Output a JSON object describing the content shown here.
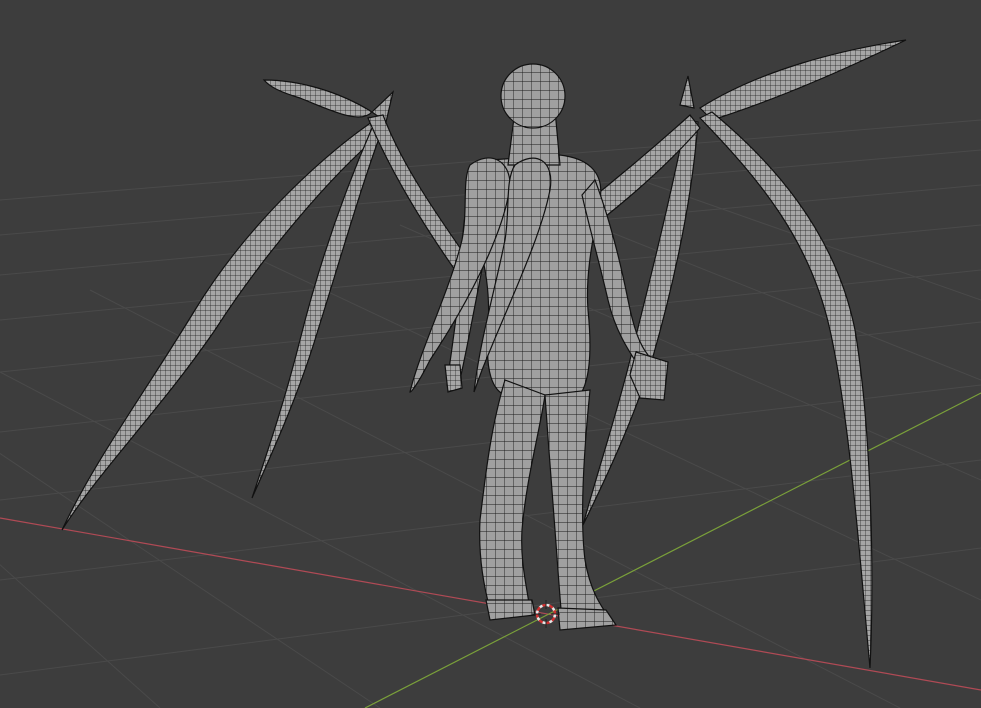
{
  "viewport": {
    "view": "3d-viewport",
    "shading": "wireframe-overlay",
    "background_color": "#3d3d3d",
    "grid_color": "#4a4a4a",
    "x_axis_color": "#b04a55",
    "y_axis_color": "#7aa03a",
    "mesh_color": "#9a9a9a",
    "wire_color": "#1c1c1c",
    "cursor_icon": "3d-cursor-icon"
  },
  "object": {
    "name_semantic": "winged-humanoid-mesh",
    "parts": [
      "body",
      "head",
      "left-wing",
      "right-wing",
      "left-arm",
      "right-arm",
      "left-leg",
      "right-leg"
    ]
  }
}
